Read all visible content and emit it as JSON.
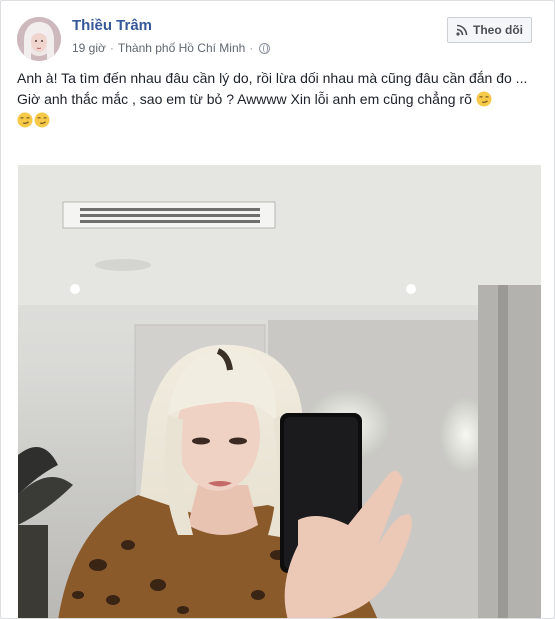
{
  "post": {
    "author": "Thiều Trâm",
    "time": "19 giờ",
    "separator": "·",
    "location": "Thành phố Hồ Chí Minh",
    "follow_label": "Theo dõi",
    "text_line1": "Anh à! Ta tìm đến nhau đâu cần lý do, rồi lừa dối nhau mà cũng đâu cần đắn đo ...",
    "text_line2": "Giờ anh thắc mắc , sao em từ bỏ ? Awwww Xin lỗi anh em cũng chẳng rõ",
    "emoji_icon": "smirk-emoji-icon",
    "privacy_icon": "globe-icon",
    "follow_icon": "rss-icon",
    "photo_description_icon": "post-photo"
  },
  "colors": {
    "author_link": "#365899",
    "text": "#1d2129",
    "meta": "#616770",
    "card_border": "#dddfe2",
    "button_bg": "#f5f6f7"
  }
}
